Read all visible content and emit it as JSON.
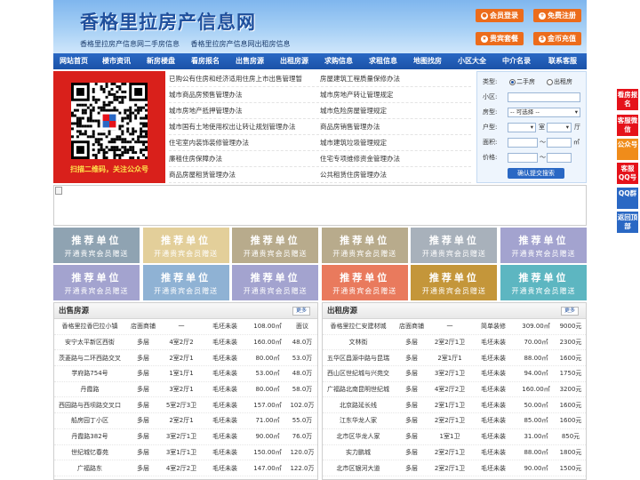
{
  "header": {
    "title": "香格里拉房产信息网",
    "subtitle": [
      "香格里拉房产信息网二手房信息",
      "香格里拉房产信息网出租房信息"
    ],
    "buttons": [
      {
        "label": "会员登录",
        "icon": "user-icon"
      },
      {
        "label": "免费注册",
        "icon": "register-icon"
      },
      {
        "label": "贵宾套餐",
        "icon": "vip-icon"
      },
      {
        "label": "金币充值",
        "icon": "coin-icon"
      }
    ],
    "colors": {
      "button": "#ec6c1b",
      "nav": "#1a52a8",
      "title": "#1f4f9c"
    }
  },
  "nav": [
    "网站首页",
    "楼市资讯",
    "新房楼盘",
    "看房报名",
    "出售房源",
    "出租房源",
    "求购信息",
    "求租信息",
    "地图找房",
    "小区大全",
    "中介名录",
    "联系客服"
  ],
  "qr": {
    "caption": "扫描二维码，关注公众号"
  },
  "links": [
    [
      "已购公有住房和经济适用住房上市出售管理暂",
      "房屋建筑工程质量保修办法"
    ],
    [
      "城市商品房预售管理办法",
      "城市房地产转让管理规定"
    ],
    [
      "城市房地产抵押管理办法",
      "城市危险房屋管理规定"
    ],
    [
      "城市国有土地使用权出让转让规划管理办法",
      "商品房销售管理办法"
    ],
    [
      "住宅室内装饰装修管理办法",
      "城市建筑垃圾管理规定"
    ],
    [
      "廉租住房保障办法",
      "住宅专项维修资金管理办法"
    ],
    [
      "商品房屋租赁管理办法",
      "公共租赁住房管理办法"
    ]
  ],
  "search": {
    "type_label": "类型:",
    "type_options": [
      "二手房",
      "出租房"
    ],
    "community_label": "小区:",
    "house_type_label": "房型:",
    "house_type_value": "-- 可选择 --",
    "layout_label": "户型:",
    "room_unit": "室",
    "hall_unit": "厅",
    "area_label": "面积:",
    "area_unit": "㎡",
    "price_label": "价格:",
    "price_sep": "～",
    "submit": "确认提交搜索"
  },
  "ads": {
    "line1": "推荐单位",
    "line2": "开通贵宾会员赠送",
    "colors": [
      "#8fa3b2",
      "#e3cf9a",
      "#b8ab8c",
      "#b8ab8c",
      "#a8b1bb",
      "#a3a3cf",
      "#a3a3cf",
      "#8fb2d4",
      "#a3a3cf",
      "#e97a5d",
      "#c4963a",
      "#5db6c1"
    ]
  },
  "sale": {
    "title": "出售房源",
    "more": "更多",
    "rows": [
      [
        "香格里拉香巴拉小镇",
        "店面商铺",
        "一",
        "毛坯未装",
        "108.00㎡",
        "面议"
      ],
      [
        "安宁太平新区西街",
        "多层",
        "4室2厅2",
        "毛坯未装",
        "160.00㎡",
        "48.0万"
      ],
      [
        "茨菱路与二环西路交叉",
        "多层",
        "2室2厅1",
        "毛坯未装",
        "80.00㎡",
        "53.0万"
      ],
      [
        "学府路754号",
        "多层",
        "1室1厅1",
        "毛坯未装",
        "53.00㎡",
        "48.0万"
      ],
      [
        "丹霞路",
        "多层",
        "3室2厅1",
        "毛坯未装",
        "80.00㎡",
        "58.0万"
      ],
      [
        "西园路与西坝路交叉口",
        "多层",
        "5室2厅3卫",
        "毛坯未装",
        "157.00㎡",
        "102.0万"
      ],
      [
        "船房园丁小区",
        "多层",
        "2室2厅1",
        "毛坯未装",
        "71.00㎡",
        "55.0万"
      ],
      [
        "丹霞路382号",
        "多层",
        "3室2厅1卫",
        "毛坯未装",
        "90.00㎡",
        "76.0万"
      ],
      [
        "世纪城忆春苑",
        "多层",
        "3室1厅1卫",
        "毛坯未装",
        "150.00㎡",
        "120.0万"
      ],
      [
        "广福路东",
        "多层",
        "4室2厅2卫",
        "毛坯未装",
        "147.00㎡",
        "122.0万"
      ]
    ]
  },
  "rent": {
    "title": "出租房源",
    "more": "更多",
    "rows": [
      [
        "香格里拉仁安建材城",
        "店面商铺",
        "一",
        "简单装修",
        "309.00㎡",
        "9000元"
      ],
      [
        "文林街",
        "多层",
        "2室2厅1卫",
        "毛坯未装",
        "70.00㎡",
        "2300元"
      ],
      [
        "五华区昌源中路与昆瑞",
        "多层",
        "2室1厅1",
        "毛坯未装",
        "88.00㎡",
        "1600元"
      ],
      [
        "西山区世纪城与兴苑交",
        "多层",
        "3室2厅1卫",
        "毛坯未装",
        "94.00㎡",
        "1750元"
      ],
      [
        "广福路北南昆明世纪城",
        "多层",
        "4室2厅2卫",
        "毛坯未装",
        "160.00㎡",
        "3200元"
      ],
      [
        "北京路延长线",
        "多层",
        "2室1厅1卫",
        "毛坯未装",
        "50.00㎡",
        "1600元"
      ],
      [
        "江东华龙人家",
        "多层",
        "2室2厅1卫",
        "毛坯未装",
        "85.00㎡",
        "1600元"
      ],
      [
        "北市区华龙人家",
        "多层",
        "1室1卫",
        "毛坯未装",
        "31.00㎡",
        "850元"
      ],
      [
        "实力鹏城",
        "多层",
        "2室2厅1卫",
        "毛坯未装",
        "88.00㎡",
        "1800元"
      ],
      [
        "北市区银河大道",
        "多层",
        "2室2厅1卫",
        "毛坯未装",
        "90.00㎡",
        "1500元"
      ]
    ]
  },
  "float": [
    {
      "label": "看房报名",
      "color": "#e5121a"
    },
    {
      "label": "客服微信",
      "color": "#e5121a"
    },
    {
      "label": "公众号",
      "color": "#f08c1a"
    },
    {
      "label": "客服QQ号",
      "color": "#e5121a"
    },
    {
      "label": "QQ群",
      "color": "#2a68c4"
    },
    {
      "label": "返回顶部",
      "color": "#2a68c4"
    }
  ]
}
